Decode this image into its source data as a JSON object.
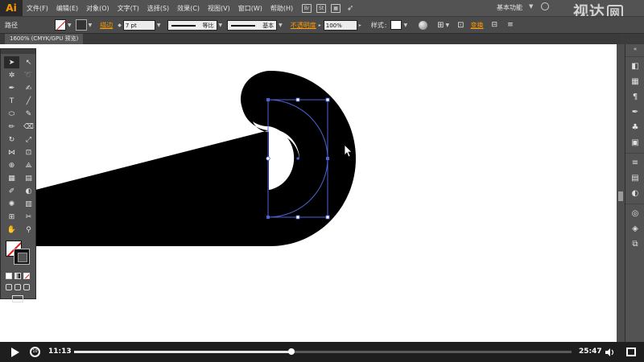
{
  "app": {
    "logo": "Ai",
    "workspace": "基本功能",
    "watermark": "视达",
    "watermark_box": "网"
  },
  "menu": [
    "文件(F)",
    "编辑(E)",
    "对象(O)",
    "文字(T)",
    "选择(S)",
    "效果(C)",
    "视图(V)",
    "窗口(W)",
    "帮助(H)"
  ],
  "control": {
    "label": "路径",
    "stroke_link": "描边",
    "stroke_weight": "7 pt",
    "line1_text": "等比",
    "line2_text": "基本",
    "opacity_link": "不透明度",
    "opacity_value": "100%",
    "style_label": "样式",
    "transform_link": "变换"
  },
  "doc": {
    "tab_label": "1600% (CMYK/GPU 预览)"
  },
  "video": {
    "current_time": "11:13",
    "total_time": "25:47",
    "progress": 0.437
  },
  "colors": {
    "accent_orange": "#ff9a00",
    "anchor_blue": "#4b63d6",
    "canvas": "#ffffff",
    "shape": "#000000"
  },
  "tools": [
    "selection-arrow",
    "direct-selection-arrow",
    "magic-wand",
    "lasso",
    "pen",
    "curvature",
    "type",
    "line",
    "ellipse",
    "paintbrush",
    "pencil",
    "eraser",
    "rotate",
    "scale",
    "width",
    "free-transform",
    "shape-builder",
    "perspective",
    "mesh",
    "gradient",
    "eyedropper",
    "blend",
    "symbol-sprayer",
    "column-graph",
    "artboard",
    "slice",
    "hand",
    "zoom"
  ],
  "right_panel_icons": [
    "collapse-arrows",
    "color-icon",
    "color-guide-icon",
    "paragraph-icon",
    "brushes-icon",
    "symbols-icon",
    "graphic-styles-icon",
    "stroke-icon",
    "gradient-icon",
    "transparency-icon",
    "appearance-icon",
    "layers-icon",
    "artboards-icon"
  ]
}
